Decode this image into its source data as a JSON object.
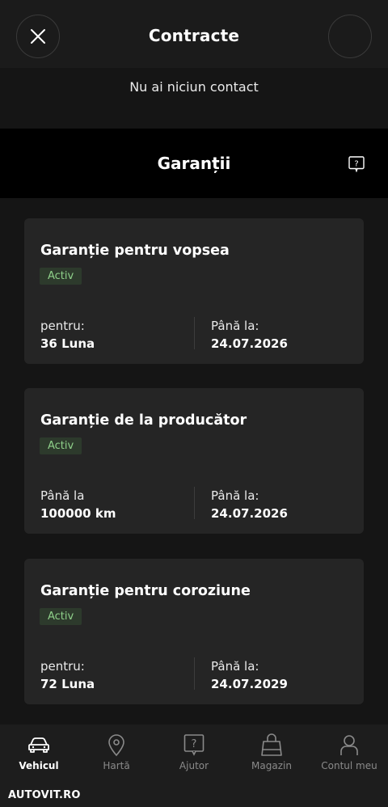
{
  "header": {
    "title": "Contracte",
    "close_icon": "close-icon"
  },
  "contacts": {
    "empty_text": "Nu ai niciun contact"
  },
  "warranties": {
    "title": "Garanții",
    "help_icon": "help-icon",
    "cards": [
      {
        "title": "Garanție pentru vopsea",
        "status": "Activ",
        "left_label": "pentru:",
        "left_value": "36 Luna",
        "right_label": "Până la:",
        "right_value": "24.07.2026"
      },
      {
        "title": "Garanție de la producător",
        "status": "Activ",
        "left_label": "Până la",
        "left_value": "100000 km",
        "right_label": "Până la:",
        "right_value": "24.07.2026"
      },
      {
        "title": "Garanție pentru coroziune",
        "status": "Activ",
        "left_label": "pentru:",
        "left_value": "72 Luna",
        "right_label": "Până la:",
        "right_value": "24.07.2029"
      }
    ]
  },
  "nav": {
    "items": [
      {
        "label": "Vehicul",
        "icon": "car-icon",
        "active": true
      },
      {
        "label": "Hartă",
        "icon": "map-pin-icon",
        "active": false
      },
      {
        "label": "Ajutor",
        "icon": "help-icon",
        "active": false
      },
      {
        "label": "Magazin",
        "icon": "shopping-bag-icon",
        "active": false
      },
      {
        "label": "Contul meu",
        "icon": "user-icon",
        "active": false
      }
    ]
  },
  "brand": {
    "text": "AUTOVIT.RO"
  },
  "colors": {
    "badge_text": "#8fd18a",
    "badge_bg": "#2d3a2c",
    "card_bg": "#252525"
  }
}
